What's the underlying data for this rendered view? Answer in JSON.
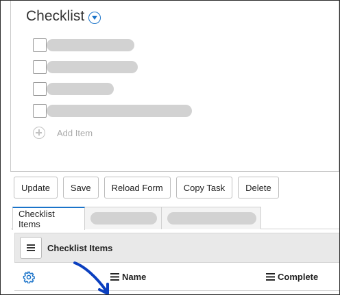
{
  "checklist": {
    "title": "Checklist",
    "add_item_label": "Add Item"
  },
  "actions": {
    "update": "Update",
    "save": "Save",
    "reload_form": "Reload Form",
    "copy_task": "Copy Task",
    "delete": "Delete"
  },
  "tabs": {
    "active_label": "Checklist Items"
  },
  "grid": {
    "title": "Checklist Items",
    "columns": {
      "name": "Name",
      "complete": "Complete"
    }
  },
  "colors": {
    "accent": "#1a73c9",
    "annotation_arrow": "#0b3fbf"
  },
  "icons": [
    "chevron-down-icon",
    "plus-circle-icon",
    "hamburger-menu-icon",
    "gear-icon"
  ]
}
